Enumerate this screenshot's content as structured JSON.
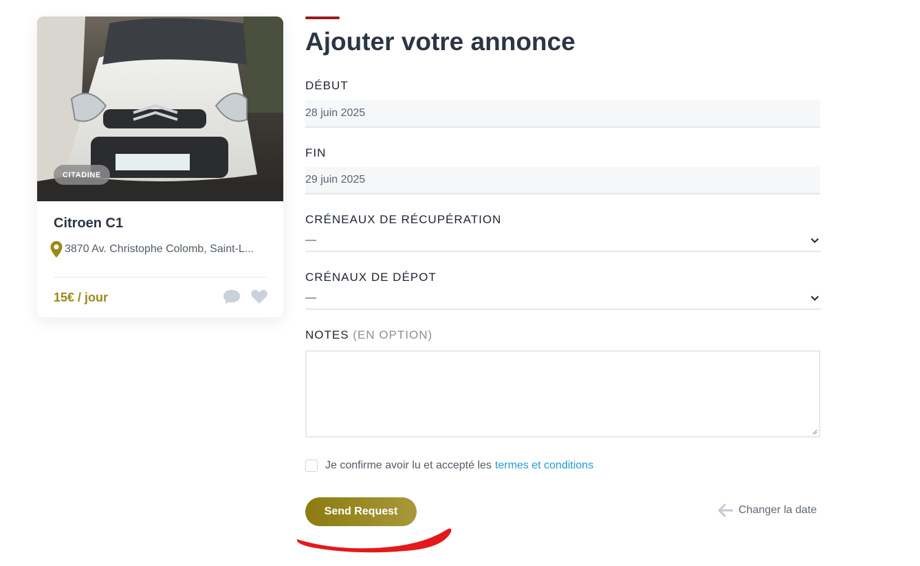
{
  "listing": {
    "category_badge": "CITADINE",
    "title": "Citroen C1",
    "address": "3870 Av. Christophe Colomb, Saint-L...",
    "price": "15€ / jour",
    "icons": {
      "location": "map-pin-icon",
      "message": "chat-bubble-icon",
      "favorite": "heart-icon"
    }
  },
  "form": {
    "title": "Ajouter votre annonce",
    "start": {
      "label": "DÉBUT",
      "value": "28 juin 2025"
    },
    "end": {
      "label": "FIN",
      "value": "29 juin 2025"
    },
    "pickup_slots": {
      "label": "CRÉNEAUX DE RÉCUPÉRATION",
      "value": "—"
    },
    "dropoff_slots": {
      "label": "CRÉNAUX DE DÉPOT",
      "value": "—"
    },
    "notes": {
      "label": "NOTES",
      "optional": "(EN OPTION)",
      "value": ""
    },
    "consent": {
      "text": "Je confirme avoir lu et accepté les",
      "link": "termes et conditions",
      "checked": false
    },
    "submit_label": "Send Request",
    "change_date_label": "Changer la date"
  },
  "colors": {
    "accent_red": "#9c1b1b",
    "brand_olive": "#9a8a19",
    "link_blue": "#1f9bd0",
    "annotation_red": "#e4191b"
  }
}
